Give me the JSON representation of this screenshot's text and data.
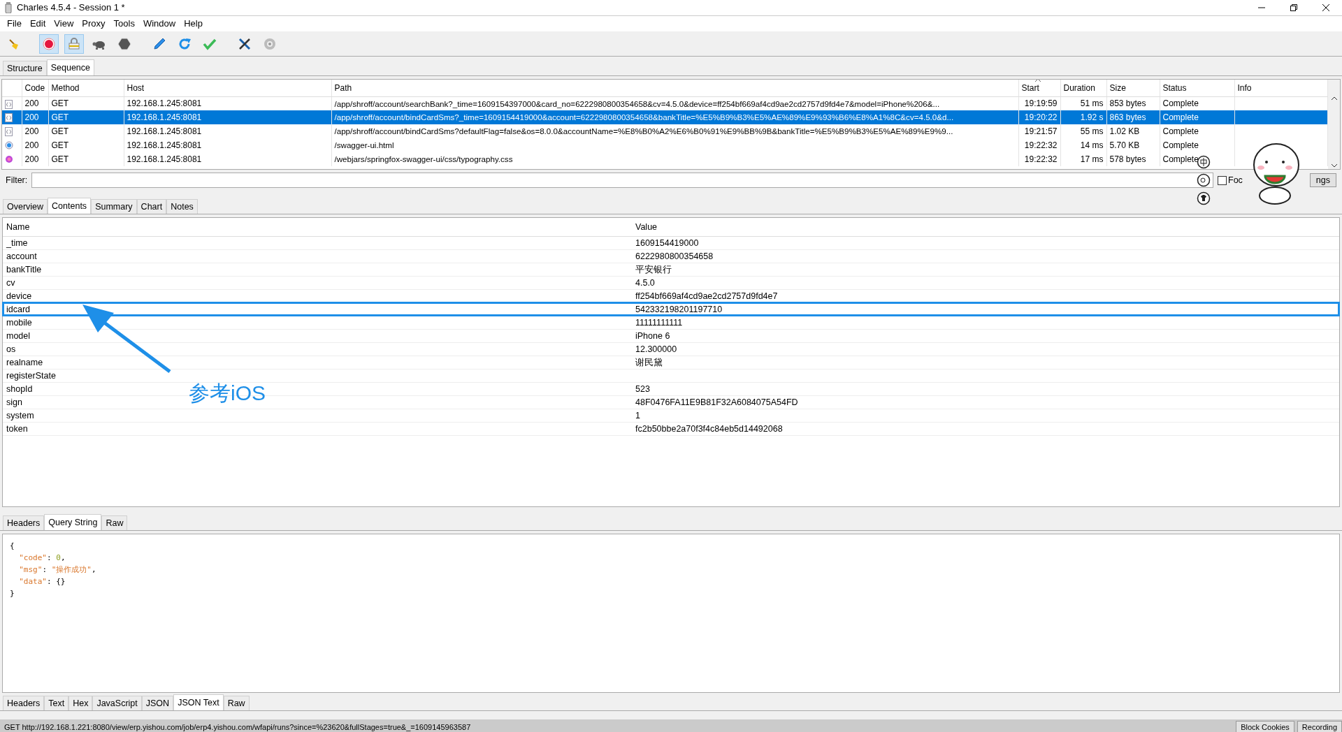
{
  "window": {
    "title": "Charles 4.5.4 - Session 1 *"
  },
  "menu": [
    {
      "label": "File"
    },
    {
      "label": "Edit"
    },
    {
      "label": "View"
    },
    {
      "label": "Proxy"
    },
    {
      "label": "Tools"
    },
    {
      "label": "Window"
    },
    {
      "label": "Help"
    }
  ],
  "toolbar": [
    {
      "kind": "broom",
      "pressed": false
    },
    {
      "kind": "separator"
    },
    {
      "kind": "record",
      "pressed": true
    },
    {
      "kind": "lock",
      "pressed": true
    },
    {
      "kind": "turtle",
      "pressed": false
    },
    {
      "kind": "stop",
      "pressed": false
    },
    {
      "kind": "separator"
    },
    {
      "kind": "pen",
      "pressed": false
    },
    {
      "kind": "refresh",
      "pressed": false
    },
    {
      "kind": "check",
      "pressed": false
    },
    {
      "kind": "separator"
    },
    {
      "kind": "tools",
      "pressed": false
    },
    {
      "kind": "gear",
      "pressed": false
    }
  ],
  "view_tabs": [
    {
      "label": "Structure",
      "selected": false
    },
    {
      "label": "Sequence",
      "selected": true
    }
  ],
  "sessions": {
    "columns": [
      {
        "label": "Code",
        "sorted": false
      },
      {
        "label": "Method",
        "sorted": false
      },
      {
        "label": "Host",
        "sorted": false
      },
      {
        "label": "Path",
        "sorted": false
      },
      {
        "label": "Start",
        "sorted": true
      },
      {
        "label": "Duration",
        "sorted": false
      },
      {
        "label": "Size",
        "sorted": false
      },
      {
        "label": "Status",
        "sorted": false
      },
      {
        "label": "Info",
        "sorted": false
      }
    ],
    "rows": [
      {
        "kind": "json",
        "selected": false,
        "code": "200",
        "method": "GET",
        "host": "192.168.1.245:8081",
        "path": "/app/shroff/account/searchBank?_time=1609154397000&card_no=6222980800354658&cv=4.5.0&device=ff254bf669af4cd9ae2cd2757d9fd4e7&model=iPhone%206&...",
        "start": "19:19:59",
        "duration": "51 ms",
        "size": "853 bytes",
        "status": "Complete"
      },
      {
        "kind": "json",
        "selected": true,
        "code": "200",
        "method": "GET",
        "host": "192.168.1.245:8081",
        "path": "/app/shroff/account/bindCardSms?_time=1609154419000&account=6222980800354658&bankTitle=%E5%B9%B3%E5%AE%89%E9%93%B6%E8%A1%8C&cv=4.5.0&d...",
        "start": "19:20:22",
        "duration": "1.92 s",
        "size": "863 bytes",
        "status": "Complete"
      },
      {
        "kind": "json",
        "selected": false,
        "code": "200",
        "method": "GET",
        "host": "192.168.1.245:8081",
        "path": "/app/shroff/account/bindCardSms?defaultFlag=false&os=8.0.0&accountName=%E8%B0%A2%E6%B0%91%E9%BB%9B&bankTitle=%E5%B9%B3%E5%AE%89%E9%9...",
        "start": "19:21:57",
        "duration": "55 ms",
        "size": "1.02 KB",
        "status": "Complete"
      },
      {
        "kind": "html",
        "selected": false,
        "code": "200",
        "method": "GET",
        "host": "192.168.1.245:8081",
        "path": "/swagger-ui.html",
        "start": "19:22:32",
        "duration": "14 ms",
        "size": "5.70 KB",
        "status": "Complete"
      },
      {
        "kind": "css",
        "selected": false,
        "code": "200",
        "method": "GET",
        "host": "192.168.1.245:8081",
        "path": "/webjars/springfox-swagger-ui/css/typography.css",
        "start": "19:22:32",
        "duration": "17 ms",
        "size": "578 bytes",
        "status": "Complete"
      }
    ]
  },
  "filter": {
    "label": "Filter:",
    "focus_checked": false,
    "focus_label": "Foc",
    "settings_label": "ngs"
  },
  "detail_tabs": [
    {
      "label": "Overview",
      "selected": false
    },
    {
      "label": "Contents",
      "selected": true
    },
    {
      "label": "Summary",
      "selected": false
    },
    {
      "label": "Chart",
      "selected": false
    },
    {
      "label": "Notes",
      "selected": false
    }
  ],
  "query": {
    "columns": [
      "Name",
      "Value"
    ],
    "rows": [
      {
        "name": "_time",
        "value": "1609154419000",
        "highlighted": false
      },
      {
        "name": "account",
        "value": "6222980800354658",
        "highlighted": false
      },
      {
        "name": "bankTitle",
        "value": "平安银行",
        "highlighted": false
      },
      {
        "name": "cv",
        "value": "4.5.0",
        "highlighted": false
      },
      {
        "name": "device",
        "value": "ff254bf669af4cd9ae2cd2757d9fd4e7",
        "highlighted": false
      },
      {
        "name": "idcard",
        "value": "542332198201197710",
        "highlighted": true
      },
      {
        "name": "mobile",
        "value": "11111111111",
        "highlighted": false
      },
      {
        "name": "model",
        "value": "iPhone 6",
        "highlighted": false
      },
      {
        "name": "os",
        "value": "12.300000",
        "highlighted": false
      },
      {
        "name": "realname",
        "value": "谢民黛",
        "highlighted": false
      },
      {
        "name": "registerState",
        "highlighted": false
      },
      {
        "name": "shopId",
        "value": "523",
        "highlighted": false
      },
      {
        "name": "sign",
        "value": "48F0476FA11E9B81F32A6084075A54FD",
        "highlighted": false
      },
      {
        "name": "system",
        "value": "1",
        "highlighted": false
      },
      {
        "name": "token",
        "value": "fc2b50bbe2a70f3f4c84eb5d14492068",
        "highlighted": false
      }
    ]
  },
  "annotation": {
    "text": "参考iOS"
  },
  "request_tabs": [
    {
      "label": "Headers",
      "selected": false
    },
    {
      "label": "Query String",
      "selected": true
    },
    {
      "label": "Raw",
      "selected": false
    }
  ],
  "response_body": [
    "{",
    "  \"code\": 0,",
    "  \"msg\": \"操作成功\",",
    "  \"data\": {}",
    "}"
  ],
  "response_tabs": [
    {
      "label": "Headers",
      "selected": false
    },
    {
      "label": "Text",
      "selected": false
    },
    {
      "label": "Hex",
      "selected": false
    },
    {
      "label": "JavaScript",
      "selected": false
    },
    {
      "label": "JSON",
      "selected": false
    },
    {
      "label": "JSON Text",
      "selected": true
    },
    {
      "label": "Raw",
      "selected": false
    }
  ],
  "status_bar": {
    "text": "GET http://192.168.1.221:8080/view/erp.yishou.com/job/erp4.yishou.com/wfapi/runs?since=%23620&fullStages=true&_=1609145963587",
    "buttons": [
      "Block Cookies",
      "Recording"
    ]
  }
}
